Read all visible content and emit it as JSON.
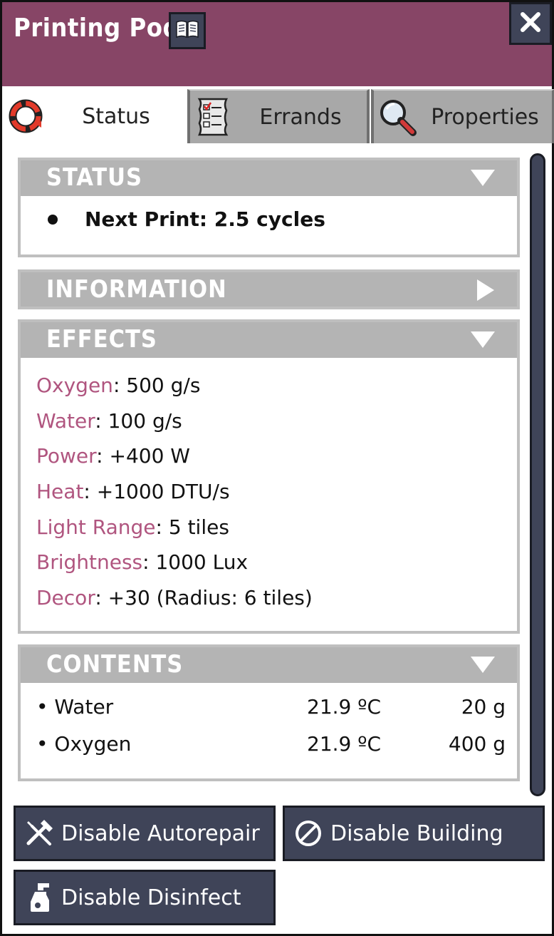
{
  "window": {
    "title": "Printing Pod"
  },
  "icons": {
    "codex": "open-book-icon",
    "close": "close-icon",
    "status_tab": "status-ring-icon",
    "errands_tab": "checklist-icon",
    "properties_tab": "magnifier-icon",
    "autorepair": "wrench-hammer-icon",
    "building": "prohibit-icon",
    "disinfect": "spray-bottle-icon"
  },
  "colors": {
    "header": "#874566",
    "effect_key": "#b0557f",
    "button": "#3f4458",
    "section_header": "#b4b4b4"
  },
  "tabs": [
    {
      "label": "Status",
      "active": true
    },
    {
      "label": "Errands",
      "active": false
    },
    {
      "label": "Properties",
      "active": false
    }
  ],
  "sections": {
    "status": {
      "title": "STATUS",
      "expanded": true,
      "items": [
        "Next Print: 2.5 cycles"
      ]
    },
    "information": {
      "title": "INFORMATION",
      "expanded": false
    },
    "effects": {
      "title": "EFFECTS",
      "expanded": true,
      "items": [
        {
          "key": "Oxygen",
          "value": ": 500 g/s"
        },
        {
          "key": "Water",
          "value": ": 100 g/s"
        },
        {
          "key": "Power",
          "value": ": +400 W"
        },
        {
          "key": "Heat",
          "value": ": +1000 DTU/s"
        },
        {
          "key": "Light Range",
          "value": ": 5 tiles"
        },
        {
          "key": "Brightness",
          "value": ": 1000 Lux"
        },
        {
          "key": "Decor",
          "value": ": +30 (Radius: 6 tiles)"
        }
      ]
    },
    "contents": {
      "title": "CONTENTS",
      "expanded": true,
      "rows": [
        {
          "name": "• Water",
          "temp": "21.9 ºC",
          "mass": "20 g"
        },
        {
          "name": "• Oxygen",
          "temp": "21.9 ºC",
          "mass": "400 g"
        }
      ]
    }
  },
  "actions": {
    "autorepair": "Disable Autorepair",
    "building": "Disable Building",
    "disinfect": "Disable Disinfect"
  }
}
